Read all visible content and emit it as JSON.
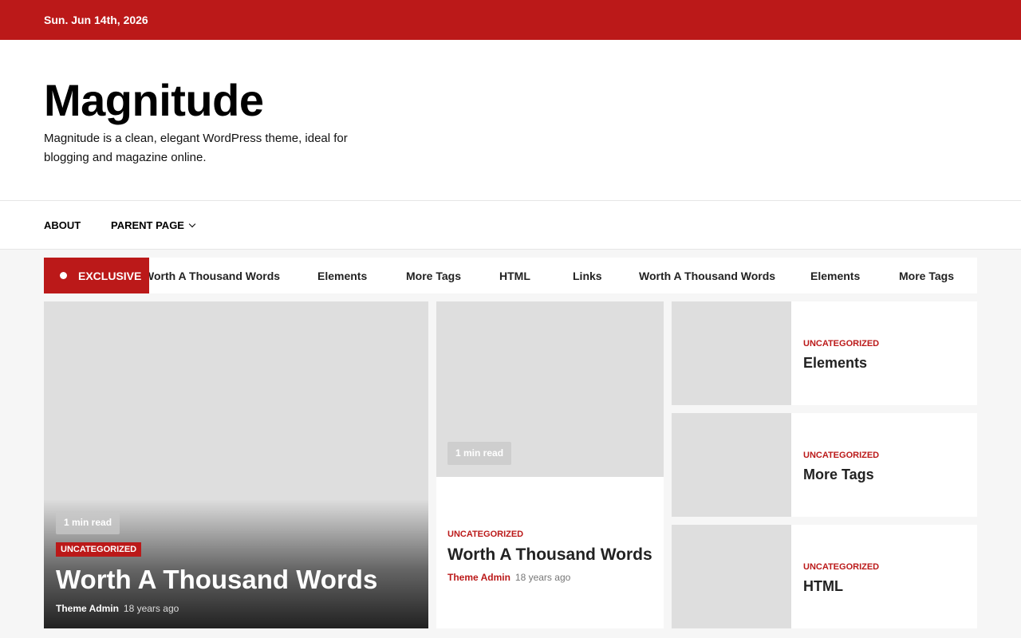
{
  "topbar": {
    "date": "Sun. Jun 14th, 2026"
  },
  "site": {
    "title": "Magnitude",
    "tagline": "Magnitude is a clean, elegant WordPress theme, ideal for blogging and magazine online."
  },
  "nav": {
    "items": [
      {
        "label": "ABOUT"
      },
      {
        "label": "PARENT PAGE"
      }
    ]
  },
  "ticker": {
    "label": "EXCLUSIVE",
    "items": [
      "Worth A Thousand Words",
      "Elements",
      "More Tags",
      "HTML",
      "Links",
      "Worth A Thousand Words",
      "Elements",
      "More Tags"
    ]
  },
  "featured": {
    "read_time": "1 min read",
    "category": "UNCATEGORIZED",
    "title": "Worth A Thousand Words",
    "author": "Theme Admin",
    "ago": "18 years ago"
  },
  "middle": {
    "read_time": "1 min read",
    "category": "UNCATEGORIZED",
    "title": "Worth A Thousand Words",
    "author": "Theme Admin",
    "ago": "18 years ago"
  },
  "side_posts": [
    {
      "category": "UNCATEGORIZED",
      "title": "Elements"
    },
    {
      "category": "UNCATEGORIZED",
      "title": "More Tags"
    },
    {
      "category": "UNCATEGORIZED",
      "title": "HTML"
    }
  ],
  "colors": {
    "accent": "#bb1919",
    "placeholder": "#dedede"
  }
}
